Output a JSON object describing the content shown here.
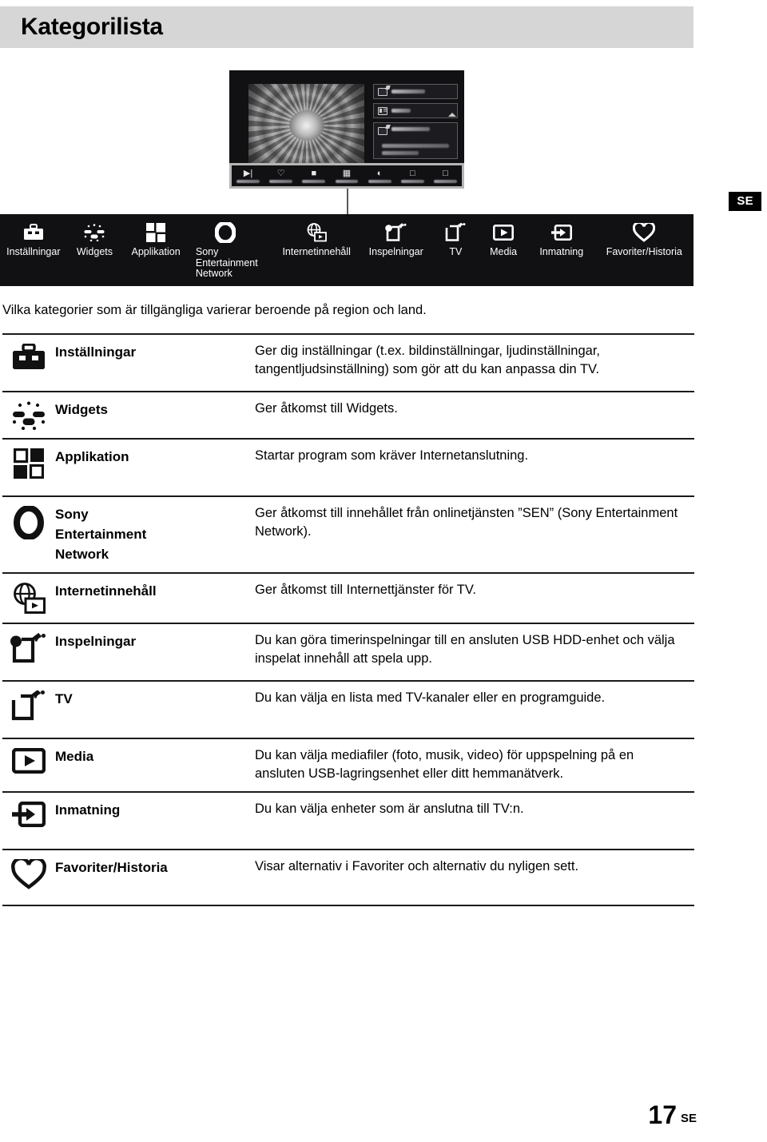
{
  "header": {
    "title": "Kategorilista"
  },
  "region_badge": {
    "label": "SE"
  },
  "tv_mockup": {
    "menu_items": [
      {
        "icon": "screen-edit-icon",
        "label_blurred": true
      },
      {
        "icon": "list-icon",
        "label_blurred": true
      },
      {
        "icon": "screen-edit-icon",
        "label_blurred": true,
        "has_description": true
      }
    ],
    "dock_items": [
      {
        "icon": "input-icon",
        "label_blurred": true
      },
      {
        "icon": "heart-icon",
        "label_blurred": true
      },
      {
        "icon": "toolbox-icon",
        "label_blurred": true
      },
      {
        "icon": "apps-icon",
        "label_blurred": true
      },
      {
        "icon": "widgets-icon",
        "label_blurred": true
      },
      {
        "icon": "tv-icon",
        "label_blurred": true
      },
      {
        "icon": "hdmi-icon",
        "label_blurred": true
      }
    ]
  },
  "category_bar": {
    "items": [
      {
        "icon": "toolbox-icon",
        "label": "Inställningar"
      },
      {
        "icon": "widgets-icon",
        "label": "Widgets"
      },
      {
        "icon": "apps-icon",
        "label": "Applikation"
      },
      {
        "icon": "sen-ring-icon",
        "label": "Sony\nEntertainment\nNetwork"
      },
      {
        "icon": "internet-content-icon",
        "label": "Internetinnehåll"
      },
      {
        "icon": "recordings-icon",
        "label": "Inspelningar"
      },
      {
        "icon": "tv-icon",
        "label": "TV"
      },
      {
        "icon": "media-icon",
        "label": "Media"
      },
      {
        "icon": "input-icon",
        "label": "Inmatning"
      },
      {
        "icon": "heart-icon",
        "label": "Favoriter/Historia"
      }
    ]
  },
  "intro_note": "Vilka kategorier som är tillgängliga varierar beroende på region och land.",
  "table": {
    "rows": [
      {
        "icon": "toolbox-icon",
        "name": "Inställningar",
        "description": "Ger dig inställningar (t.ex. bildinställningar, ljudinställningar, tangentljudsinställning) som gör att du kan anpassa din TV."
      },
      {
        "icon": "widgets-icon",
        "name": "Widgets",
        "description": "Ger åtkomst till Widgets."
      },
      {
        "icon": "apps-icon",
        "name": "Applikation",
        "description": "Startar program som kräver Internetanslutning."
      },
      {
        "icon": "sen-ring-icon",
        "name": "Sony\nEntertainment\nNetwork",
        "description": "Ger åtkomst till innehållet från onlinetjänsten ”SEN” (Sony Entertainment Network)."
      },
      {
        "icon": "internet-content-icon",
        "name": "Internetinnehåll",
        "description": "Ger åtkomst till Internettjänster för TV."
      },
      {
        "icon": "recordings-icon",
        "name": "Inspelningar",
        "description": "Du kan göra timerinspelningar till en ansluten USB HDD-enhet och välja inspelat innehåll att spela upp."
      },
      {
        "icon": "tv-icon",
        "name": "TV",
        "description": "Du kan välja en lista med TV-kanaler eller en programguide."
      },
      {
        "icon": "media-icon",
        "name": "Media",
        "description": "Du kan välja mediafiler (foto, musik, video) för uppspelning på en ansluten USB-lagringsenhet eller ditt hemmanätverk."
      },
      {
        "icon": "input-icon",
        "name": "Inmatning",
        "description": "Du kan välja enheter som är anslutna till TV:n."
      },
      {
        "icon": "heart-icon",
        "name": "Favoriter/Historia",
        "description": "Visar alternativ i Favoriter och alternativ du nyligen sett."
      }
    ]
  },
  "footer": {
    "page_number": "17",
    "page_suffix": "SE"
  },
  "colors": {
    "header_bg": "#d6d6d6",
    "dark_panel": "#111114",
    "rule": "#1a1a1a",
    "text": "#000000"
  }
}
